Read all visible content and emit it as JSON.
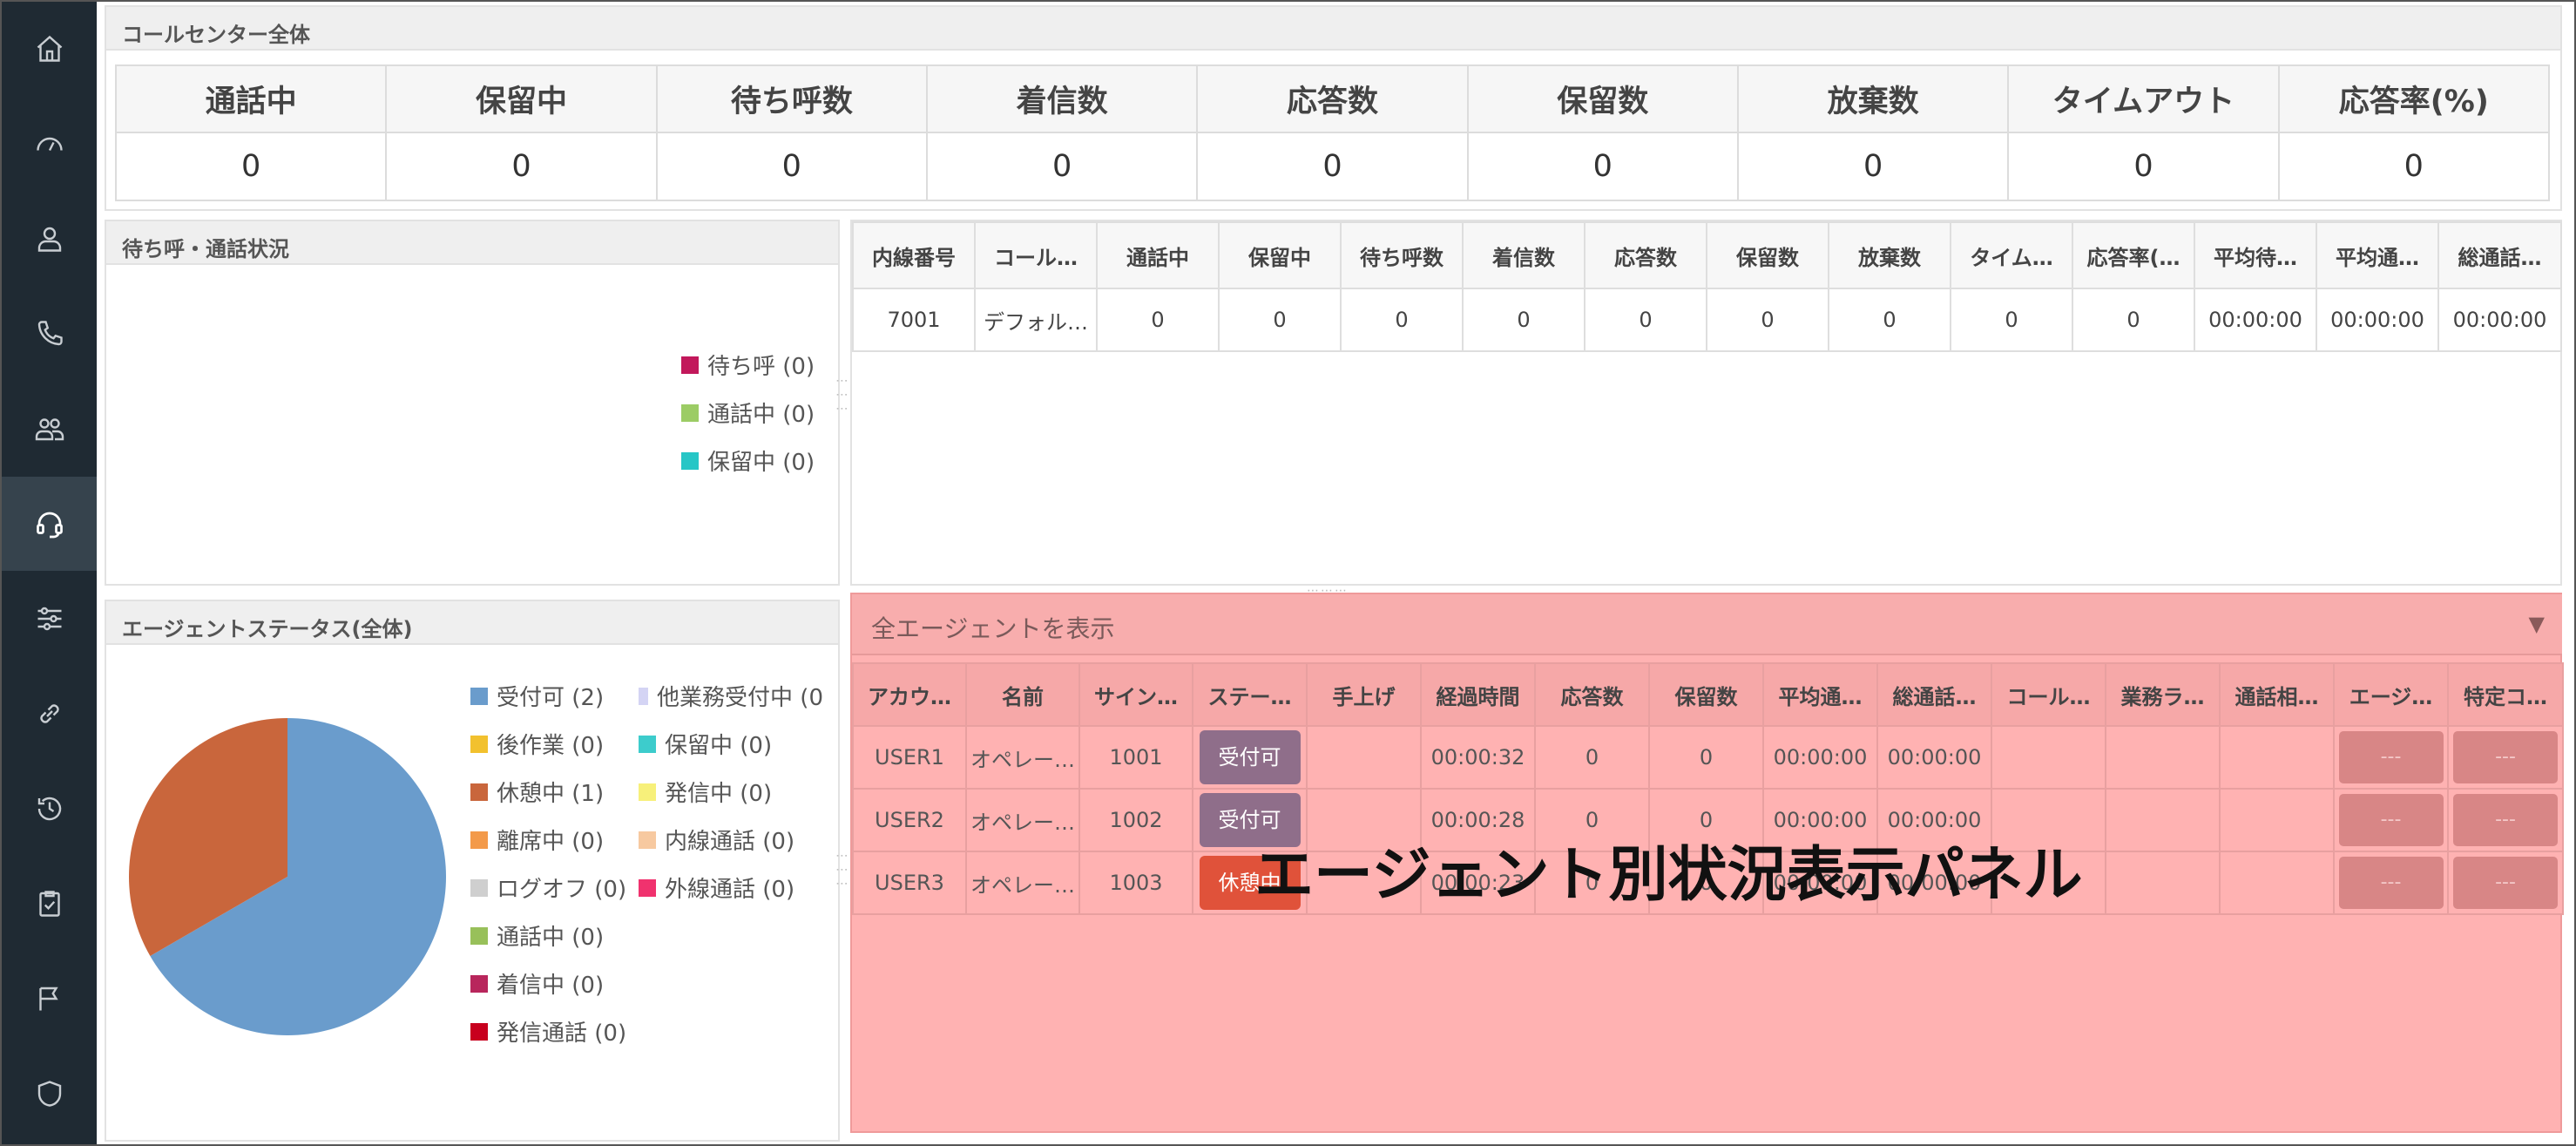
{
  "summary": {
    "title": "コールセンター全体",
    "headers": [
      "通話中",
      "保留中",
      "待ち呼数",
      "着信数",
      "応答数",
      "保留数",
      "放棄数",
      "タイムアウト",
      "応答率(%)"
    ],
    "values": [
      "0",
      "0",
      "0",
      "0",
      "0",
      "0",
      "0",
      "0",
      "0"
    ]
  },
  "waiting": {
    "title": "待ち呼・通話状況",
    "legend": [
      {
        "label": "待ち呼 (0)",
        "color": "#c2185b"
      },
      {
        "label": "通話中 (0)",
        "color": "#9ccc65"
      },
      {
        "label": "保留中 (0)",
        "color": "#26c6c6"
      }
    ]
  },
  "extensions": {
    "headers": [
      "内線番号",
      "コール…",
      "通話中",
      "保留中",
      "待ち呼数",
      "着信数",
      "応答数",
      "保留数",
      "放棄数",
      "タイム…",
      "応答率(…",
      "平均待…",
      "平均通…",
      "総通話…"
    ],
    "rows": [
      [
        "7001",
        "デフォル…",
        "0",
        "0",
        "0",
        "0",
        "0",
        "0",
        "0",
        "0",
        "0",
        "00:00:00",
        "00:00:00",
        "00:00:00"
      ]
    ]
  },
  "agent_status": {
    "title": "エージェントステータス(全体)",
    "legend": [
      {
        "label": "受付可 (2)",
        "color": "#6a9ccc"
      },
      {
        "label": "他業務受付中 (0",
        "color": "#d4d4f4"
      },
      {
        "label": "後作業 (0)",
        "color": "#f2c12e"
      },
      {
        "label": "保留中 (0)",
        "color": "#3dcccc"
      },
      {
        "label": "休憩中 (1)",
        "color": "#c9663c"
      },
      {
        "label": "発信中 (0)",
        "color": "#f7f07a"
      },
      {
        "label": "離席中 (0)",
        "color": "#f39a4a"
      },
      {
        "label": "内線通話 (0)",
        "color": "#f7c9a0"
      },
      {
        "label": "ログオフ (0)",
        "color": "#cfcfcf"
      },
      {
        "label": "外線通話 (0)",
        "color": "#f0326e"
      },
      {
        "label": "通話中 (0)",
        "color": "#98c05a"
      },
      {
        "label": "着信中 (0)",
        "color": "#b8265c"
      },
      {
        "label": "発信通話 (0)",
        "color": "#c8001e"
      }
    ]
  },
  "chart_data": {
    "type": "pie",
    "categories": [
      "受付可",
      "休憩中"
    ],
    "values": [
      2,
      1
    ],
    "colors": [
      "#6a9ccc",
      "#c9663c"
    ]
  },
  "agents": {
    "filter_label": "全エージェントを表示",
    "headers": [
      "アカウ…",
      "名前",
      "サイン…",
      "ステー…",
      "手上げ",
      "経過時間",
      "応答数",
      "保留数",
      "平均通…",
      "総通話…",
      "コール…",
      "業務ラ…",
      "通話相…",
      "エージ…",
      "特定コ…"
    ],
    "rows": [
      {
        "account": "USER1",
        "name": "オペレー…",
        "sign": "1001",
        "status": "受付可",
        "status_color": "#8f6e8a",
        "elapsed": "00:00:32",
        "answered": "0",
        "held": "0",
        "avg": "00:00:00",
        "total": "00:00:00",
        "btn1": "---",
        "btn2": "---"
      },
      {
        "account": "USER2",
        "name": "オペレー…",
        "sign": "1002",
        "status": "受付可",
        "status_color": "#8f6e8a",
        "elapsed": "00:00:28",
        "answered": "0",
        "held": "0",
        "avg": "00:00:00",
        "total": "00:00:00",
        "btn1": "---",
        "btn2": "---"
      },
      {
        "account": "USER3",
        "name": "オペレー…",
        "sign": "1003",
        "status": "休憩中",
        "status_color": "#e0523a",
        "elapsed": "00:00:23",
        "answered": "0",
        "held": "0",
        "avg": "00:00:00",
        "total": "00:00:00",
        "btn1": "---",
        "btn2": "---"
      }
    ]
  },
  "overlay": {
    "label": "エージェント別状況表示パネル"
  },
  "nav": [
    "home-icon",
    "dashboard-icon",
    "user-icon",
    "phone-icon",
    "users-icon",
    "headset-icon",
    "sliders-icon",
    "link-icon",
    "history-icon",
    "checklist-icon",
    "flag-icon",
    "shield-icon"
  ]
}
